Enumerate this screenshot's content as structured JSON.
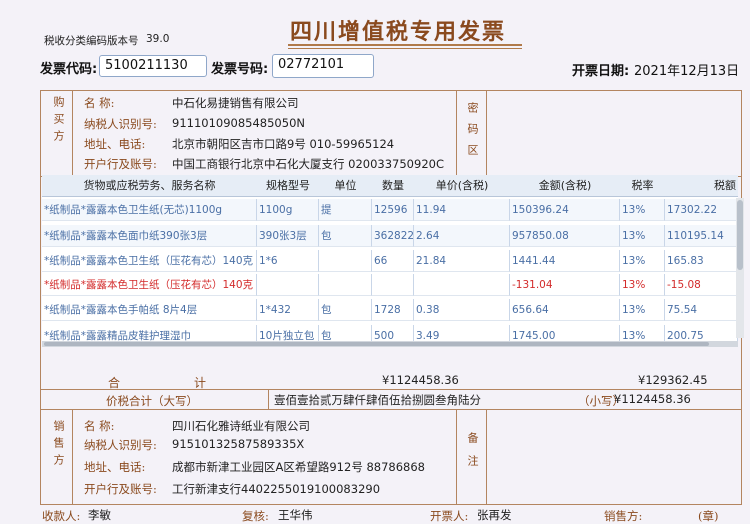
{
  "header": {
    "version_label": "税收分类编码版本号",
    "version_value": "39.0",
    "title": "四川增值税专用发票",
    "invoice_code_label": "发票代码:",
    "invoice_code": "5100211130",
    "invoice_no_label": "发票号码:",
    "invoice_no": "02772101",
    "date_label": "开票日期:",
    "date_value": "2021年12月13日"
  },
  "buyer": {
    "side_label": "购买方",
    "name_label": "名    称:",
    "name": "中石化易捷销售有限公司",
    "taxid_label": "纳税人识别号:",
    "taxid": "91110109085485050N",
    "addr_label": "地址、电话:",
    "addr": "北京市朝阳区吉市口路9号 010-59965124",
    "bank_label": "开户行及账号:",
    "bank": "中国工商银行北京中石化大厦支行 020033750920C"
  },
  "cipher_label": "密码区",
  "items_table": {
    "headers": [
      "货物或应税劳务、服务名称",
      "规格型号",
      "单位",
      "数量",
      "单价(含税)",
      "金额(含税)",
      "税率",
      "税额"
    ],
    "rows": [
      {
        "name": "*纸制品*露露本色卫生纸(无芯)1100g",
        "spec": "1100g",
        "unit": "提",
        "qty": "12596",
        "price": "11.94",
        "amount": "150396.24",
        "rate": "13%",
        "tax": "17302.22",
        "negative": false
      },
      {
        "name": "*纸制品*露露本色面巾纸390张3层",
        "spec": "390张3层",
        "unit": "包",
        "qty": "362822",
        "price": "2.64",
        "amount": "957850.08",
        "rate": "13%",
        "tax": "110195.14",
        "negative": false
      },
      {
        "name": "*纸制品*露露本色卫生纸（压花有芯）140克",
        "spec": "1*6",
        "unit": "",
        "qty": "66",
        "price": "21.84",
        "amount": "1441.44",
        "rate": "13%",
        "tax": "165.83",
        "negative": false
      },
      {
        "name": "*纸制品*露露本色卫生纸（压花有芯）140克",
        "spec": "",
        "unit": "",
        "qty": "",
        "price": "",
        "amount": "-131.04",
        "rate": "13%",
        "tax": "-15.08",
        "negative": true
      },
      {
        "name": "*纸制品*露露本色手帕纸 8片4层",
        "spec": "1*432",
        "unit": "包",
        "qty": "1728",
        "price": "0.38",
        "amount": "656.64",
        "rate": "13%",
        "tax": "75.54",
        "negative": false
      },
      {
        "name": "*纸制品*露露精品皮鞋护理湿巾",
        "spec": "10片独立包",
        "unit": "包",
        "qty": "500",
        "price": "3.49",
        "amount": "1745.00",
        "rate": "13%",
        "tax": "200.75",
        "negative": false
      }
    ]
  },
  "totals": {
    "label_he": "合",
    "label_ji": "计",
    "amount": "¥1124458.36",
    "tax": "¥129362.45",
    "grand_label": "价税合计（大写）",
    "grand_words": "壹佰壹拾贰万肆仟肆佰伍拾捌圆叁角陆分",
    "small_label": "（小写）",
    "grand_small": "¥1124458.36"
  },
  "seller": {
    "side_label": "销售方",
    "name_label": "名    称:",
    "name": "四川石化雅诗纸业有限公司",
    "taxid_label": "纳税人识别号:",
    "taxid": "91510132587589335X",
    "addr_label": "地址、电话:",
    "addr": "成都市新津工业园区A区希望路912号 88786868",
    "bank_label": "开户行及账号:",
    "bank": "工行新津支行4402255019100083290"
  },
  "remark_label": "备注",
  "footer": {
    "payee_label": "收款人:",
    "payee": "李敏",
    "reviewer_label": "复核:",
    "reviewer": "王华伟",
    "issuer_label": "开票人:",
    "issuer": "张再发",
    "seller_label": "销售方:",
    "seal": "(章)"
  }
}
